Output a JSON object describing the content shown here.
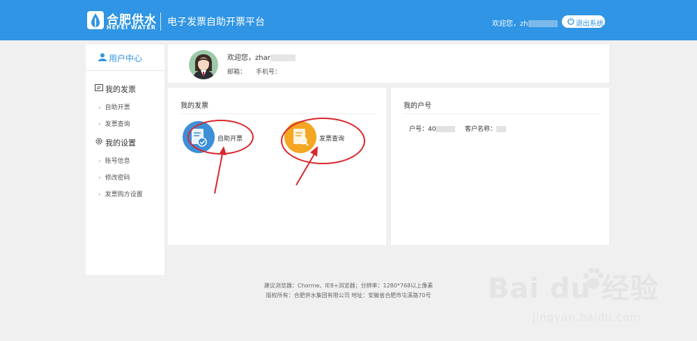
{
  "header": {
    "logo_cn": "合肥供水",
    "logo_en": "HEFEI WATER",
    "platform_title": "电子发票自助开票平台",
    "welcome": "欢迎您，zh",
    "logout_label": "退出系统",
    "colors": {
      "bar": "#2f95e4"
    }
  },
  "sidebar": {
    "header_label": "用户中心",
    "groups": [
      {
        "label": "我的发票",
        "icon": "invoice-icon",
        "items": [
          "自助开票",
          "发票查询"
        ]
      },
      {
        "label": "我的设置",
        "icon": "gear-icon",
        "items": [
          "账号信息",
          "修改密码",
          "发票购方设置"
        ]
      }
    ]
  },
  "user": {
    "welcome": "欢迎您，zhar",
    "email_label": "邮箱：",
    "phone_label": "手机号："
  },
  "invoice_panel": {
    "title": "我的发票",
    "items": [
      {
        "label": "自助开票",
        "icon": "self-invoice-icon",
        "color": "#3d8fd8"
      },
      {
        "label": "发票查询",
        "icon": "invoice-search-icon",
        "color": "#f5a623"
      }
    ],
    "annotation_color": "#d9262b"
  },
  "account_panel": {
    "title": "我的户号",
    "account_label": "户号：40",
    "customer_label": "客户名称："
  },
  "footer": {
    "line1": "建议浏览器：Chorme、IE8+浏览器；分辨率：1280*768以上像素",
    "line2": "版权所有：合肥供水集团有限公司 地址：安徽省合肥市屯溪路70号"
  },
  "watermark": {
    "brand": "Bai du 经验",
    "url": "jingyan.baidu.com"
  }
}
